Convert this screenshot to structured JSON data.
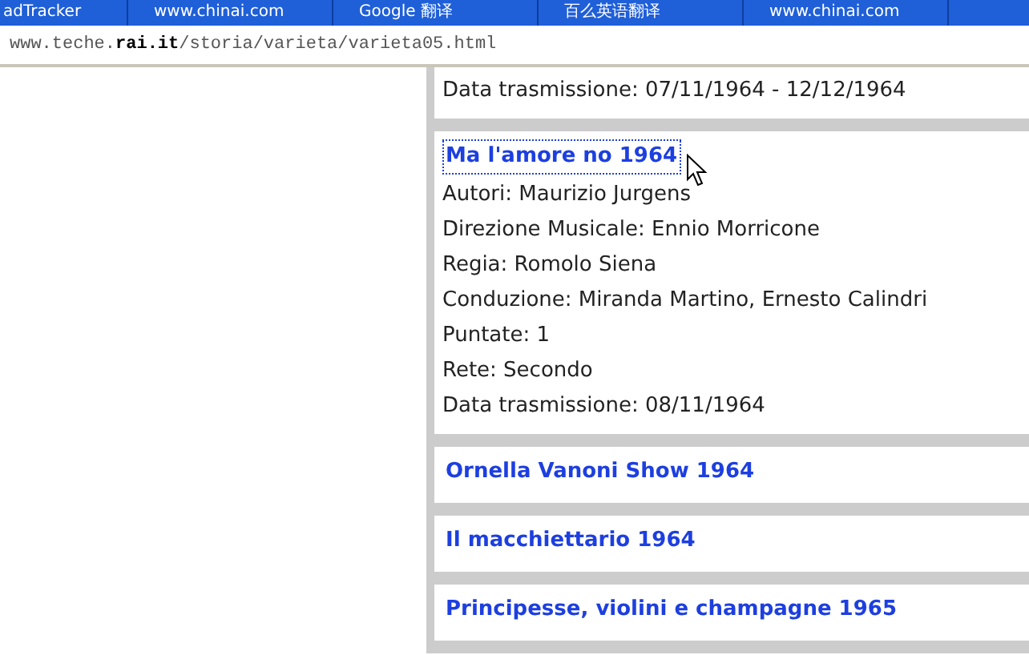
{
  "browser": {
    "tabs": [
      {
        "label": "adTracker"
      },
      {
        "label": "www.chinai.com"
      },
      {
        "label": "Google 翻译"
      },
      {
        "label": "百么英语翻译"
      },
      {
        "label": "www.chinai.com"
      }
    ],
    "address": "www.teche.**rai.it**/storia/varieta/varieta05.html"
  },
  "programs": [
    {
      "details": [
        "Data trasmissione: 07/11/1964 - 12/12/1964"
      ]
    },
    {
      "title": "Ma l'amore no 1964",
      "focused": true,
      "details": [
        "Autori: Maurizio Jurgens",
        "Direzione Musicale: Ennio Morricone",
        "Regia: Romolo Siena",
        "Conduzione: Miranda Martino, Ernesto Calindri",
        "Puntate: 1",
        "Rete: Secondo",
        "Data trasmissione: 08/11/1964"
      ]
    },
    {
      "title": "Ornella Vanoni Show 1964",
      "focused": false
    },
    {
      "title": "Il macchiettario 1964",
      "focused": false
    },
    {
      "title": "Principesse, violini e champagne 1965",
      "focused": false
    }
  ]
}
